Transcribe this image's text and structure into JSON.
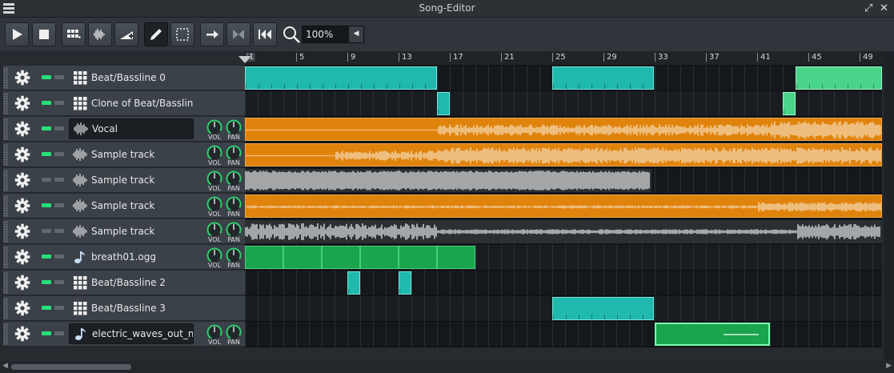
{
  "window": {
    "title": "Song-Editor"
  },
  "toolbar": {
    "buttons": [
      "play",
      "stop",
      "add-beat-bassline",
      "add-sample-track",
      "add-automation-track",
      "draw-mode",
      "edit-mode",
      "auto-scroll",
      "loop-points",
      "stop-behaviour"
    ],
    "zoom": "100%"
  },
  "ruler": {
    "ticks": [
      "1",
      "5",
      "9",
      "13",
      "17",
      "21",
      "25",
      "29",
      "33",
      "37",
      "41",
      "45",
      "49"
    ]
  },
  "tracks": [
    {
      "name": "Beat/Bassline 0",
      "type": "bb",
      "muted": false,
      "boxed": false,
      "knobs": false
    },
    {
      "name": "Clone of Beat/Basslin...",
      "type": "bb",
      "muted": false,
      "boxed": false,
      "knobs": false
    },
    {
      "name": "Vocal",
      "type": "sample",
      "muted": false,
      "boxed": true,
      "knobs": true
    },
    {
      "name": "Sample track",
      "type": "sample",
      "muted": false,
      "boxed": false,
      "knobs": true
    },
    {
      "name": "Sample track",
      "type": "sample",
      "muted": true,
      "boxed": false,
      "knobs": true
    },
    {
      "name": "Sample track",
      "type": "sample",
      "muted": false,
      "boxed": false,
      "knobs": true
    },
    {
      "name": "Sample track",
      "type": "sample",
      "muted": true,
      "boxed": false,
      "knobs": true
    },
    {
      "name": "breath01.ogg",
      "type": "instrument",
      "muted": false,
      "boxed": false,
      "knobs": true
    },
    {
      "name": "Beat/Bassline 2",
      "type": "bb",
      "muted": false,
      "boxed": false,
      "knobs": false
    },
    {
      "name": "Beat/Bassline 3",
      "type": "bb",
      "muted": false,
      "boxed": false,
      "knobs": false
    },
    {
      "name": "electric_waves_out_m...",
      "type": "instrument",
      "muted": false,
      "boxed": true,
      "knobs": true
    }
  ],
  "knob_labels": {
    "vol": "VOL",
    "pan": "PAN"
  },
  "colors": {
    "bb": "#1fb9ae",
    "bb_alt": "#4ad48a",
    "sample": "#e0830c",
    "instrument": "#1aa44c",
    "mute_on": "#26e07a"
  }
}
